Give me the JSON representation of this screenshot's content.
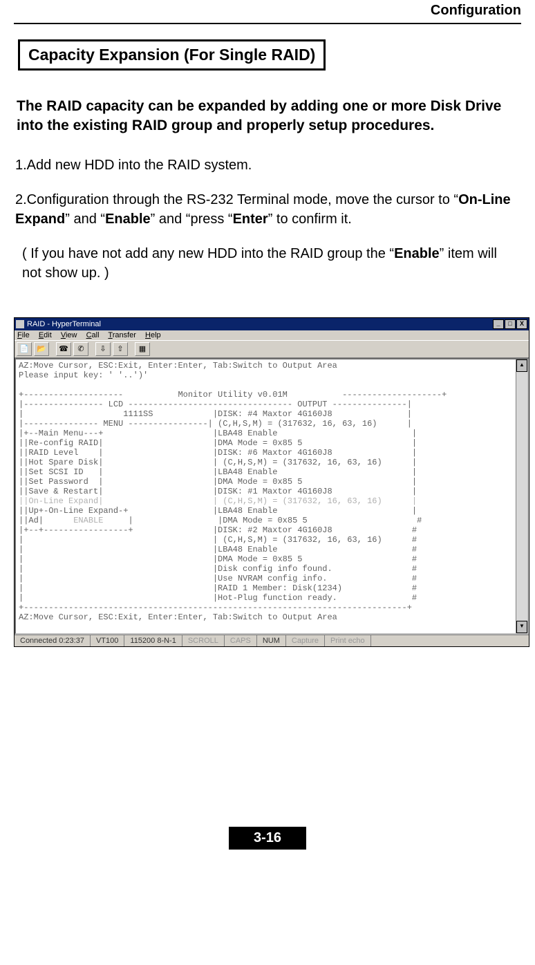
{
  "header": {
    "section": "Configuration"
  },
  "section_title": "Capacity Expansion (For Single RAID)",
  "intro": "The RAID capacity can be expanded by adding one or more Disk Drive into the existing RAID group and properly setup procedures.",
  "step1": "1.Add new HDD into the RAID system.",
  "step2": {
    "prefix": "2.Configuration through the RS-232 Terminal mode, move the cursor to “",
    "kw1": "On-Line Expand",
    "mid1": "” and “",
    "kw2": "Enable",
    "mid2": "” and “press “",
    "kw3": "Enter",
    "suffix": "” to confirm it."
  },
  "note": {
    "prefix": "( If you have not add any new HDD into the RAID group the “",
    "kw": "Enable",
    "suffix": "” item will not show up. )"
  },
  "hyperterminal": {
    "title": "RAID - HyperTerminal",
    "menu": {
      "file": "File",
      "edit": "Edit",
      "view": "View",
      "call": "Call",
      "transfer": "Transfer",
      "help": "Help"
    },
    "win_buttons": {
      "min": "_",
      "max": "□",
      "close": "X"
    },
    "toolbar_icons": [
      "new-file-icon",
      "open-file-icon",
      "connect-icon",
      "disconnect-icon",
      "send-icon",
      "receive-icon",
      "properties-icon"
    ],
    "terminal_lines_top": [
      "AZ:Move Cursor, ESC:Exit, Enter:Enter, Tab:Switch to Output Area",
      "Please input key: ' '..')'",
      "",
      "+--------------------           Monitor Utility v0.01M           --------------------+",
      "|---------------- LCD --------------------------------- OUTPUT ---------------|",
      "|                    1111SS            |DISK: #4 Maxtor 4G160J8               |",
      "|--------------- MENU ----------------| (C,H,S,M) = (317632, 16, 63, 16)      |",
      "|+--Main Menu---+                      |LBA48 Enable                           |",
      "||Re-config RAID|                      |DMA Mode = 0x85 5                      |",
      "||RAID Level    |                      |DISK: #6 Maxtor 4G160J8                |",
      "||Hot Spare Disk|                      | (C,H,S,M) = (317632, 16, 63, 16)      |",
      "||Set SCSI ID   |                      |LBA48 Enable                           |",
      "||Set Password  |                      |DMA Mode = 0x85 5                      |",
      "||Save & Restart|                      |DISK: #1 Maxtor 4G160J8                |"
    ],
    "terminal_dim_line": "||On-Line Expand|                      | (C,H,S,M) = (317632, 16, 63, 16)      |",
    "terminal_line_up": "||Up+-On-Line Expand-+                 |LBA48 Enable                           |",
    "terminal_dim_enable_prefix": "||Ad|      ",
    "terminal_dim_enable_word": "ENABLE",
    "terminal_dim_enable_suffix": "     |                 |DMA Mode = 0x85 5                      #",
    "terminal_lines_bottom": [
      "|+--+-----------------+                |DISK: #2 Maxtor 4G160J8                #",
      "|                                      | (C,H,S,M) = (317632, 16, 63, 16)      #",
      "|                                      |LBA48 Enable                           #",
      "|                                      |DMA Mode = 0x85 5                      #",
      "|                                      |Disk config info found.                #",
      "|                                      |Use NVRAM config info.                 #",
      "|                                      |RAID 1 Member: Disk(1234)              #",
      "|                                      |Hot-Plug function ready.               #",
      "+-----------------------------------------------------------------------------+",
      "AZ:Move Cursor, ESC:Exit, Enter:Enter, Tab:Switch to Output Area",
      ""
    ],
    "status": {
      "connected": "Connected 0:23:37",
      "emulation": "VT100",
      "baud": "115200 8-N-1",
      "scroll": "SCROLL",
      "caps": "CAPS",
      "num": "NUM",
      "capture": "Capture",
      "printecho": "Print echo"
    }
  },
  "page_number": "3-16"
}
